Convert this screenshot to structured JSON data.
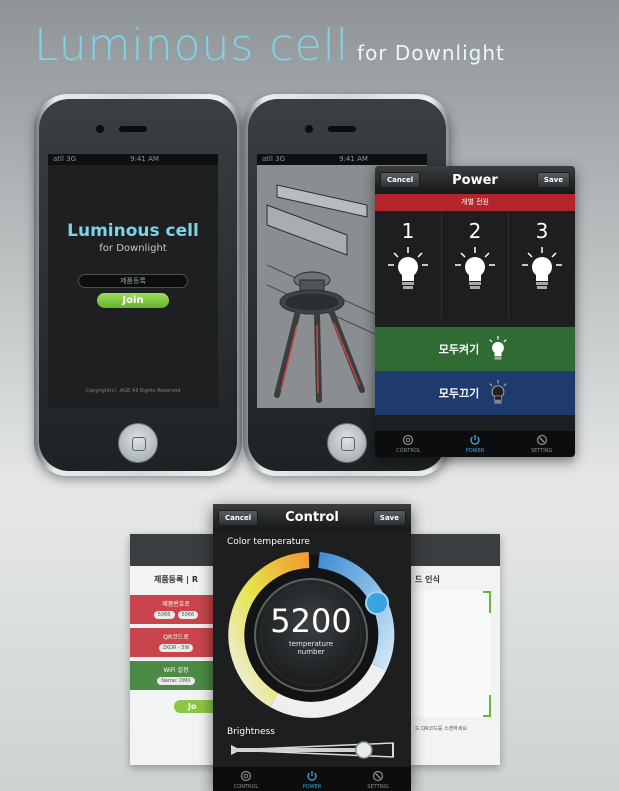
{
  "header": {
    "title": "Luminous cell",
    "subtitle": "for Downlight"
  },
  "phone1": {
    "status_carrier": "atll 3G",
    "status_time": "9:41 AM",
    "logo_title": "Luminous cell",
    "logo_subtitle": "for Downlight",
    "register_label": "제품등록",
    "join_label": "Join",
    "copyright": "Copyright(c) ,AGB All Rights Reserved"
  },
  "phone2": {
    "status_carrier": "atll 3G",
    "status_time": "9:41 AM"
  },
  "power_panel": {
    "cancel_label": "Cancel",
    "title": "Power",
    "save_label": "Save",
    "individual_power": "개별 전원",
    "channels": [
      "1",
      "2",
      "3"
    ],
    "all_on": "모두켜기",
    "all_off": "모두끄기",
    "tabs": [
      "CONTROL",
      "POWER",
      "SETTING"
    ],
    "active_tab": "POWER",
    "colors": {
      "red": "#b3252b",
      "green": "#2f6b33",
      "blue": "#1f3a6d",
      "accent": "#3aa7e6"
    }
  },
  "register_card": {
    "header": "제품등록 | R",
    "serial_label": "제품번호로",
    "serial_pills": [
      "5066",
      "5066"
    ],
    "qr_label": "QR코드로",
    "qr_value": "ZKOR - 5W",
    "wifi_label": "WiFi 설정",
    "wifi_value": "Name: DMX",
    "join_label": "Jo"
  },
  "qr_card": {
    "header": "드 인식",
    "hint": "드 QR코드를 스캔하세요"
  },
  "control_panel": {
    "cancel_label": "Cancel",
    "title": "Control",
    "save_label": "Save",
    "color_temperature_label": "Color temperature",
    "temperature_value": "5200",
    "temperature_unit_line1": "temperature",
    "temperature_unit_line2": "number",
    "brightness_label": "Brightness",
    "brightness_level": 0.82,
    "tabs": [
      "CONTROL",
      "POWER",
      "SETTING"
    ],
    "active_tab": "POWER"
  }
}
